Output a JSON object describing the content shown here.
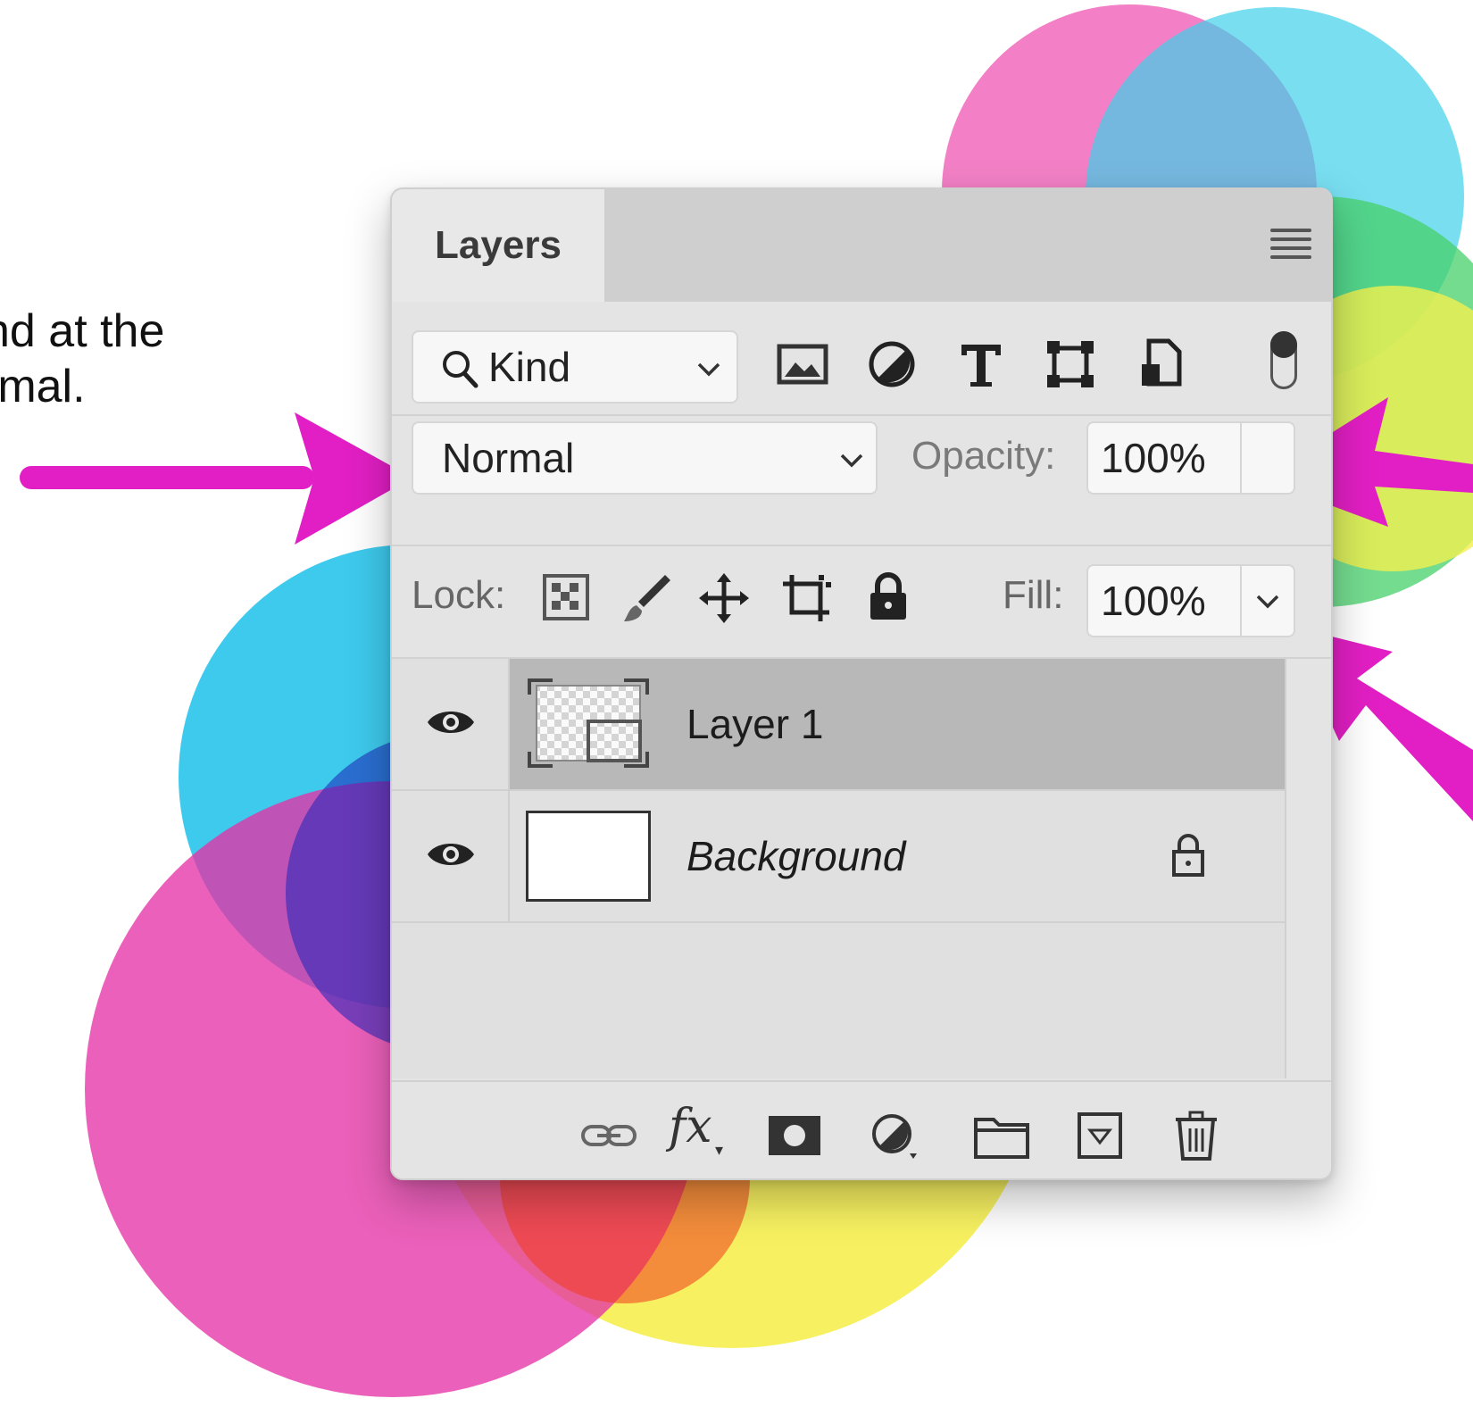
{
  "caption": {
    "line1": "nd at the",
    "line2": "rmal."
  },
  "panel": {
    "tab_label": "Layers",
    "menu_icon": "panel-menu-icon",
    "filter": {
      "search_icon": "search-icon",
      "kind_label": "Kind",
      "filter_icons": [
        "image-filter-icon",
        "adjustment-filter-icon",
        "type-filter-icon",
        "shape-filter-icon",
        "smart-object-filter-icon"
      ],
      "toggle": "filter-toggle"
    },
    "blend": {
      "mode": "Normal",
      "opacity_label": "Opacity:",
      "opacity_value": "100%"
    },
    "lock": {
      "label": "Lock:",
      "icons": [
        "lock-transparent-pixels-icon",
        "lock-image-pixels-icon",
        "lock-position-icon",
        "lock-artboard-icon",
        "lock-all-icon"
      ],
      "fill_label": "Fill:",
      "fill_value": "100%"
    },
    "layers": [
      {
        "name": "Layer 1",
        "selected": true,
        "visible": true
      },
      {
        "name": "Background",
        "selected": false,
        "visible": true,
        "locked": true
      }
    ],
    "footer_icons": [
      "link-layers-icon",
      "fx-icon",
      "layer-mask-icon",
      "adjustment-layer-icon",
      "new-group-icon",
      "new-layer-icon",
      "delete-layer-icon"
    ],
    "footer_fx_label": "fx"
  },
  "colors": {
    "arrow": "#e21fc4",
    "magenta": "#e63fa9",
    "cyan": "#2ec9e8",
    "yellow": "#f6ee4a",
    "selected_row": "#b5b5b5"
  }
}
